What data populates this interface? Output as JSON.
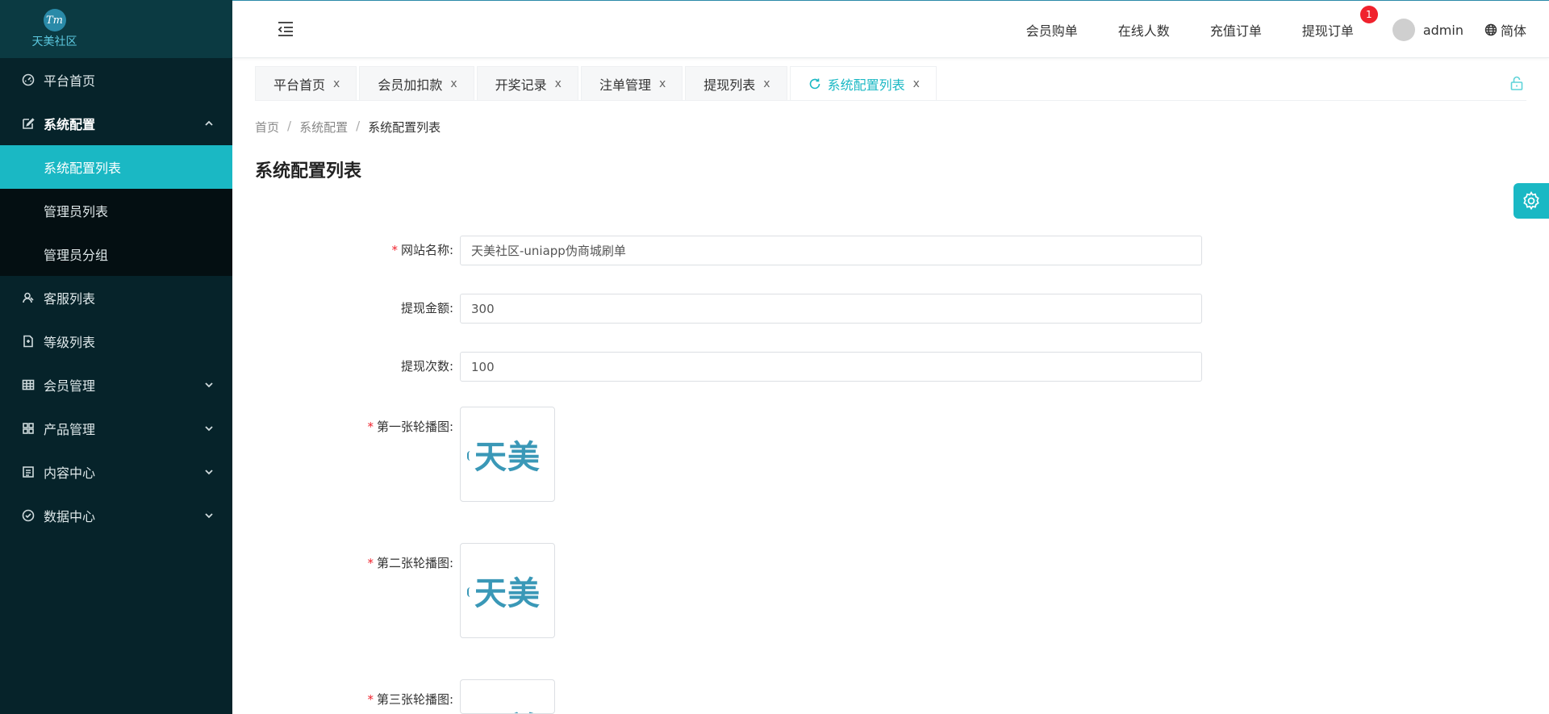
{
  "logo": {
    "mark": "Tm",
    "text": "天美社区"
  },
  "sidebar": {
    "items": [
      {
        "label": "平台首页",
        "icon": "dashboard-icon"
      },
      {
        "label": "系统配置",
        "icon": "edit-icon",
        "expanded": true,
        "children": [
          {
            "label": "系统配置列表",
            "active": true
          },
          {
            "label": "管理员列表"
          },
          {
            "label": "管理员分组"
          }
        ]
      },
      {
        "label": "客服列表",
        "icon": "user-icon"
      },
      {
        "label": "等级列表",
        "icon": "document-icon"
      },
      {
        "label": "会员管理",
        "icon": "table-icon"
      },
      {
        "label": "产品管理",
        "icon": "grid-icon"
      },
      {
        "label": "内容中心",
        "icon": "list-icon"
      },
      {
        "label": "数据中心",
        "icon": "check-circle-icon"
      }
    ]
  },
  "header": {
    "nav": [
      "会员购单",
      "在线人数",
      "充值订单",
      "提现订单"
    ],
    "withdraw_badge": "1",
    "username": "admin",
    "language": "简体"
  },
  "tabs": [
    {
      "label": "平台首页",
      "close": "x"
    },
    {
      "label": "会员加扣款",
      "close": "x"
    },
    {
      "label": "开奖记录",
      "close": "x"
    },
    {
      "label": "注单管理",
      "close": "x"
    },
    {
      "label": "提现列表",
      "close": "x"
    },
    {
      "label": "系统配置列表",
      "close": "x",
      "active": true
    }
  ],
  "breadcrumb": {
    "home": "首页",
    "parent": "系统配置",
    "current": "系统配置列表",
    "sep": "/"
  },
  "page_title": "系统配置列表",
  "form": {
    "site_name": {
      "label": "网站名称:",
      "required": true,
      "value": "天美社区-uniapp伪商城刷单"
    },
    "withdraw_amount": {
      "label": "提现金额:",
      "required": false,
      "value": "300"
    },
    "withdraw_count": {
      "label": "提现次数:",
      "required": false,
      "value": "100"
    },
    "banner1": {
      "label": "第一张轮播图:",
      "required": true,
      "image_text": "天美"
    },
    "banner2": {
      "label": "第二张轮播图:",
      "required": true,
      "image_text": "天美"
    },
    "banner3": {
      "label": "第三张轮播图:",
      "required": true,
      "image_text": "天美"
    },
    "required_mark": "*"
  },
  "colors": {
    "accent": "#1ab8c4",
    "sidebar_bg": "#06232a",
    "badge": "#f0222d"
  }
}
